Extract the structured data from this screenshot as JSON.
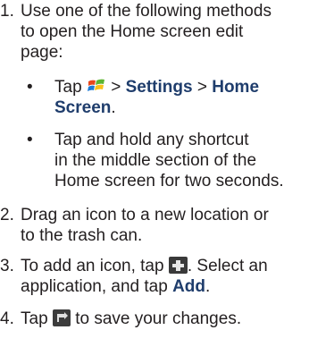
{
  "steps": [
    {
      "number": "1.",
      "lines": [
        "Use one of the following methods",
        "to open the Home screen edit",
        "page:"
      ],
      "bullets": [
        {
          "symbol": "•",
          "pre": "Tap",
          "icon": "windows-start-icon",
          "sep1": ">",
          "bold1": "Settings",
          "sep2": ">",
          "bold2a": "Home",
          "bold2b": "Screen",
          "post": "."
        },
        {
          "symbol": "•",
          "lines": [
            "Tap and hold any shortcut",
            "in the middle section of the",
            "Home screen for two seconds."
          ]
        }
      ]
    },
    {
      "number": "2.",
      "lines": [
        "Drag an icon to a new location or",
        "to the trash can."
      ]
    },
    {
      "number": "3.",
      "pre": "To add an icon, tap",
      "icon": "add-icon",
      "mid": ". Select an",
      "line2_pre": "application, and tap",
      "bold": "Add",
      "post": "."
    },
    {
      "number": "4.",
      "pre": "Tap",
      "icon": "save-icon",
      "post": "to save your changes."
    }
  ]
}
